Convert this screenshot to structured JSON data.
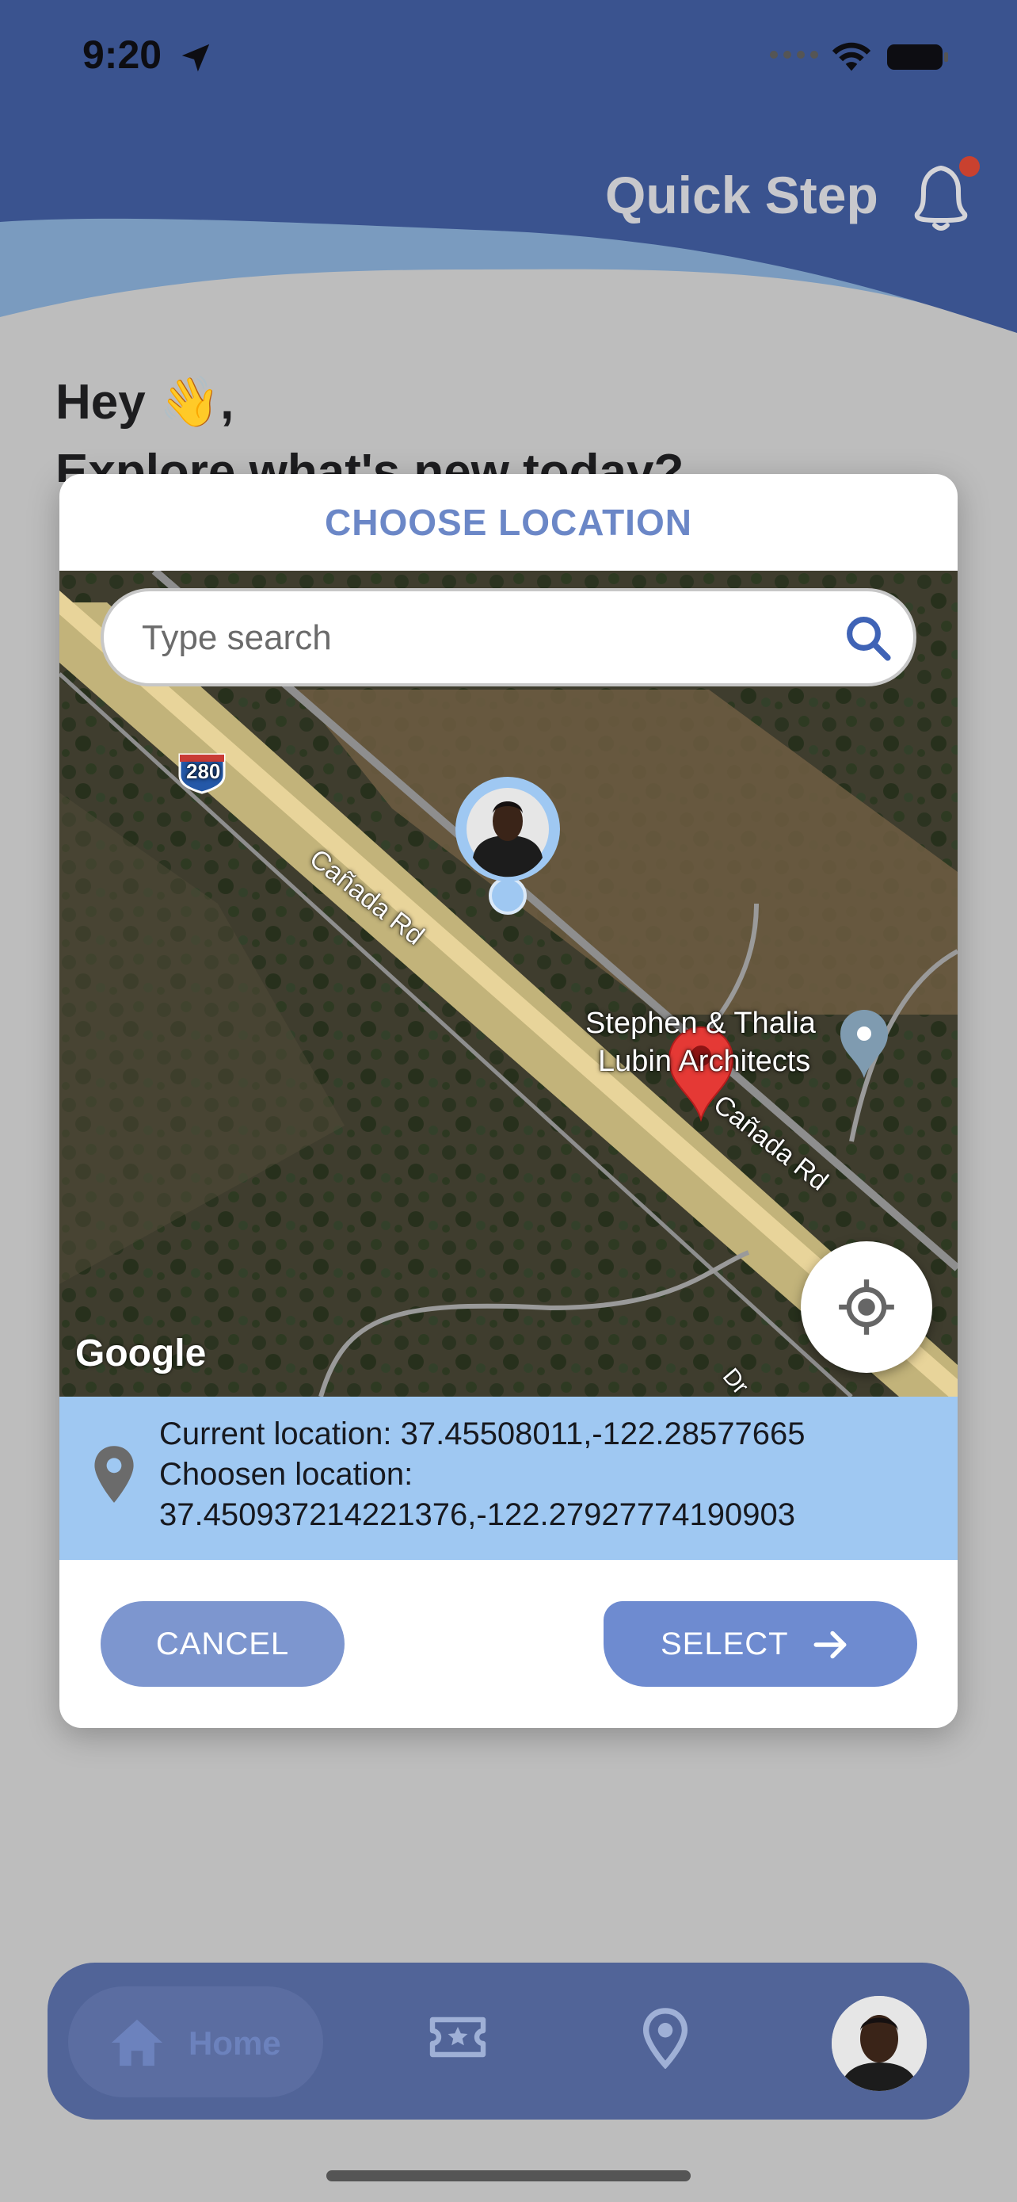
{
  "status_bar": {
    "time": "9:20"
  },
  "header": {
    "brand": "Quick Step",
    "has_notification": true
  },
  "greeting": {
    "line1": "Hey 👋,",
    "line2": "Explore what's new today?"
  },
  "modal": {
    "title": "CHOOSE LOCATION",
    "search": {
      "placeholder": "Type search",
      "value": ""
    },
    "map": {
      "labels": {
        "road1": "Cañada Rd",
        "road2": "Cañada Rd",
        "poi_line1": "Stephen & Thalia",
        "poi_line2": "Lubin Architects",
        "interstate": "280",
        "road3": "Dr"
      },
      "attribution": "Google"
    },
    "info": {
      "current_label": "Current location: 37.45508011,-122.28577665",
      "chosen_label": "Choosen location:",
      "chosen_value": "37.450937214221376,-122.27927774190903"
    },
    "buttons": {
      "cancel": "CANCEL",
      "select": "SELECT"
    }
  },
  "bottom_nav": {
    "home": "Home",
    "active": "home"
  },
  "colors": {
    "header_blue": "#3a538f",
    "accent": "#6b87c7",
    "info_panel": "#9fc8f2",
    "nav_bg": "#516498"
  }
}
